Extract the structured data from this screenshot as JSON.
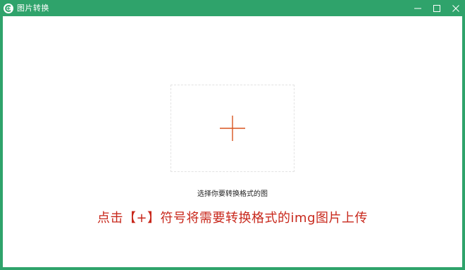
{
  "window": {
    "title": "图片转换",
    "controls": {
      "minimize": "minimize-icon",
      "maximize": "maximize-icon",
      "close": "close-icon"
    },
    "accent_color": "#2fa36b"
  },
  "upload": {
    "icon": "plus-icon",
    "icon_color": "#d9541e",
    "caption": "选择你要转换格式的图"
  },
  "annotation": {
    "text": "点击【+】符号将需要转换格式的img图片上传",
    "color": "#c8281c"
  }
}
